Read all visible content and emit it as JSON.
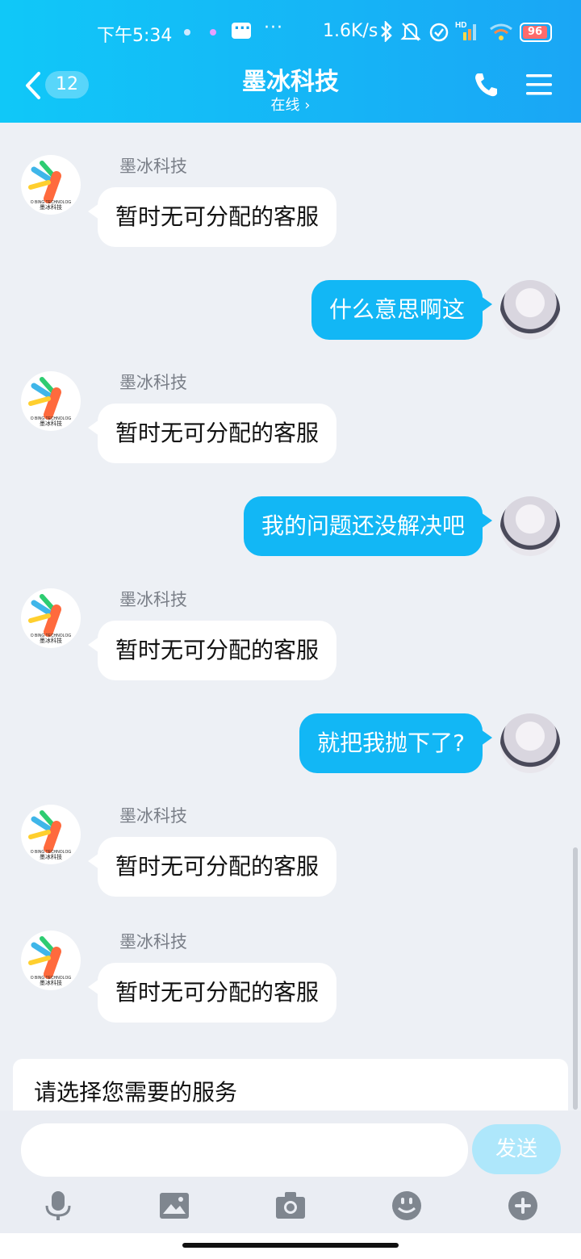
{
  "status_bar": {
    "time": "下午5:34",
    "network_speed": "1.6K/s",
    "battery": "96",
    "icons": [
      "bluetooth-icon",
      "mute-bell-icon",
      "alarm-icon",
      "signal-hd-icon",
      "wifi-icon"
    ]
  },
  "header": {
    "unread_count": "12",
    "title": "墨冰科技",
    "subtitle": "在线 ›"
  },
  "messages": [
    {
      "side": "left",
      "sender": "墨冰科技",
      "text": "暂时无可分配的客服"
    },
    {
      "side": "right",
      "text": "什么意思啊这"
    },
    {
      "side": "left",
      "sender": "墨冰科技",
      "text": "暂时无可分配的客服"
    },
    {
      "side": "right",
      "text": "我的问题还没解决吧"
    },
    {
      "side": "left",
      "sender": "墨冰科技",
      "text": "暂时无可分配的客服"
    },
    {
      "side": "right",
      "text": "就把我抛下了?"
    },
    {
      "side": "left",
      "sender": "墨冰科技",
      "text": "暂时无可分配的客服"
    },
    {
      "side": "left",
      "sender": "墨冰科技",
      "text": "暂时无可分配的客服"
    }
  ],
  "logo_text": {
    "line1": "O BING TECHNOLOG",
    "line2": "墨冰科技"
  },
  "service_card": {
    "title": "请选择您需要的服务"
  },
  "input": {
    "placeholder": "",
    "send_label": "发送"
  },
  "toolbar": [
    "microphone-icon",
    "image-icon",
    "camera-icon",
    "emoji-icon",
    "plus-icon"
  ],
  "colors": {
    "accent": "#12b7f5",
    "header_start": "#10c8f8",
    "header_end": "#1aa6f5",
    "background": "#edf0f5"
  }
}
